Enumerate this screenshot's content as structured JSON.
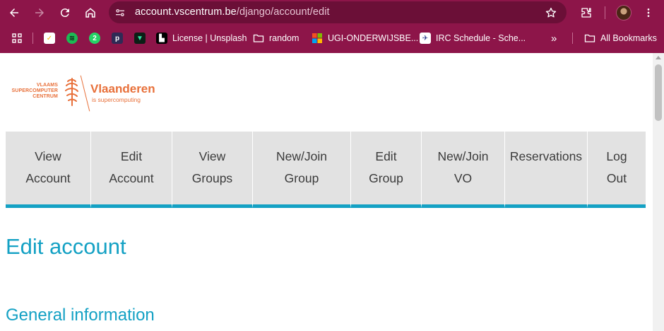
{
  "browser": {
    "url_host": "account.vscentrum.be",
    "url_path": "/django/account/edit",
    "colors": {
      "chrome": "#8d1549",
      "omnibox": "#6b0f37"
    }
  },
  "bookmarks": [
    {
      "icon": "keep-icon",
      "label": ""
    },
    {
      "icon": "spotify-icon",
      "label": ""
    },
    {
      "icon": "whatsapp-icon",
      "label": ""
    },
    {
      "icon": "pocket-icon",
      "label": ""
    },
    {
      "icon": "v-app-icon",
      "label": ""
    },
    {
      "icon": "unsplash-icon",
      "label": "License | Unsplash"
    },
    {
      "icon": "folder-icon",
      "label": "random"
    },
    {
      "icon": "microsoft-icon",
      "label": "UGI-ONDERWIJSBE..."
    },
    {
      "icon": "irc-icon",
      "label": "IRC Schedule - Sche..."
    },
    {
      "icon": "folder-icon",
      "label": "All Bookmarks"
    }
  ],
  "logo": {
    "vsc_line1": "VLAAMS",
    "vsc_line2": "SUPERCOMPUTER",
    "vsc_line3": "CENTRUM",
    "brand": "Vlaanderen",
    "tagline": "is supercomputing",
    "color": "#e8703a"
  },
  "nav": [
    {
      "label": "View\nAccount"
    },
    {
      "label": "Edit\nAccount"
    },
    {
      "label": "View\nGroups"
    },
    {
      "label": "New/Join\nGroup"
    },
    {
      "label": "Edit\nGroup"
    },
    {
      "label": "New/Join\nVO"
    },
    {
      "label": "Reservations"
    },
    {
      "label": "Log\nOut"
    }
  ],
  "nav_colors": {
    "background": "#e2e2e2",
    "accent": "#14a1c4",
    "text": "#3b3b3b"
  },
  "content": {
    "title": "Edit account",
    "section": "General information"
  }
}
